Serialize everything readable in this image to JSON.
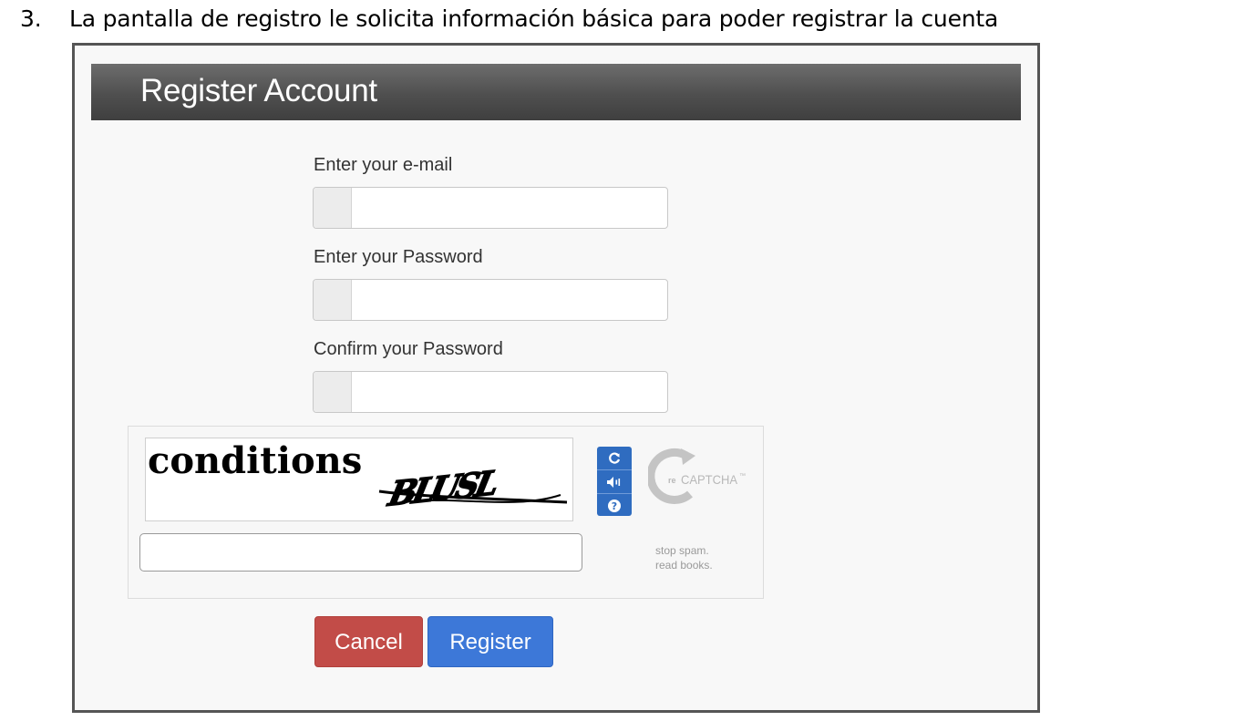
{
  "document": {
    "step_number": "3.",
    "step_text": "La pantalla de registro le solicita información básica para poder registrar la cuenta"
  },
  "form": {
    "title": "Register Account",
    "fields": [
      {
        "label": "Enter your e-mail",
        "value": "",
        "placeholder": ""
      },
      {
        "label": "Enter your Password",
        "value": "",
        "placeholder": ""
      },
      {
        "label": "Confirm your Password",
        "value": "",
        "placeholder": ""
      }
    ]
  },
  "recaptcha": {
    "challenge_words": [
      "conditions",
      "BLUSL"
    ],
    "response_value": "",
    "buttons": [
      {
        "icon": "refresh-icon"
      },
      {
        "icon": "audio-icon"
      },
      {
        "icon": "help-icon"
      }
    ],
    "logo_text": "reCAPTCHA™",
    "logo_prefix": "re",
    "logo_main": "CAPTCHA",
    "logo_tm": "™",
    "tagline": [
      "stop spam.",
      "read books."
    ],
    "accent_color": "#2f6cc0"
  },
  "actions": {
    "cancel_label": "Cancel",
    "register_label": "Register",
    "cancel_color": "#c24c48",
    "register_color": "#3d78d8"
  }
}
